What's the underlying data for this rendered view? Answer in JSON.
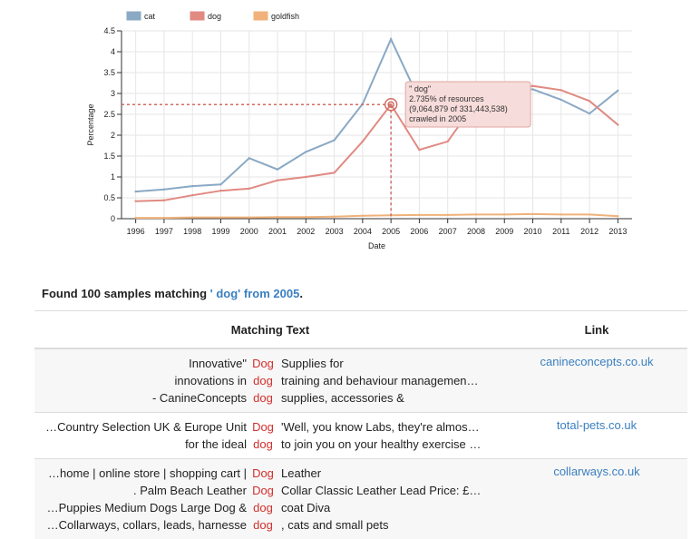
{
  "chart_data": {
    "type": "line",
    "xlabel": "Date",
    "ylabel": "Percentage",
    "x": [
      1996,
      1997,
      1998,
      1999,
      2000,
      2001,
      2002,
      2003,
      2004,
      2005,
      2006,
      2007,
      2008,
      2009,
      2010,
      2011,
      2012,
      2013
    ],
    "ylim": [
      0,
      4.5
    ],
    "yticks": [
      "0",
      "0.5",
      "1",
      "1.5",
      "2",
      "2.5",
      "3",
      "3.5",
      "4",
      "4.5"
    ],
    "legend_position": "top-left",
    "series": [
      {
        "name": "cat",
        "color": "#8aa9c4",
        "values": [
          0.65,
          0.7,
          0.78,
          0.82,
          1.45,
          1.18,
          1.6,
          1.88,
          2.75,
          4.3,
          2.85,
          2.9,
          2.95,
          3.05,
          3.1,
          2.85,
          2.52,
          3.07
        ]
      },
      {
        "name": "dog",
        "color": "#e08a82",
        "values": [
          0.42,
          0.44,
          0.56,
          0.67,
          0.72,
          0.92,
          1.0,
          1.1,
          1.85,
          2.735,
          1.65,
          1.85,
          2.8,
          3.0,
          3.18,
          3.08,
          2.82,
          2.25
        ]
      },
      {
        "name": "goldfish",
        "color": "#f0b27a",
        "values": [
          0.02,
          0.02,
          0.03,
          0.03,
          0.03,
          0.04,
          0.04,
          0.05,
          0.07,
          0.08,
          0.09,
          0.09,
          0.1,
          0.1,
          0.11,
          0.1,
          0.1,
          0.06
        ]
      }
    ],
    "highlight": {
      "series": "dog",
      "x": 2005,
      "y": 2.735
    },
    "tooltip": {
      "title": "\" dog\"",
      "line1": "2.735% of resources",
      "line2": "(9,064,879 of 331,443,538)",
      "line3": "crawled in 2005"
    }
  },
  "summary": {
    "prefix": "Found 100 samples matching ",
    "query": "' dog' from 2005",
    "suffix": "."
  },
  "table": {
    "headers": [
      "Matching Text",
      "Link"
    ],
    "rows": [
      {
        "lines": [
          {
            "pre": "Innovative\"",
            "kw": "Dog",
            "post": "Supplies for"
          },
          {
            "pre": "innovations in",
            "kw": "dog",
            "post": "training and behaviour managemen…"
          },
          {
            "pre": "- CanineConcepts",
            "kw": "dog",
            "post": "supplies, accessories &"
          }
        ],
        "link": "canineconcepts.co.uk"
      },
      {
        "lines": [
          {
            "pre": "…Country Selection UK & Europe Unit",
            "kw": "Dog",
            "post": "'Well, you know Labs, they're almos…"
          },
          {
            "pre": "for the ideal",
            "kw": "dog",
            "post": "to join you on your healthy exercise …"
          }
        ],
        "link": "total-pets.co.uk"
      },
      {
        "lines": [
          {
            "pre": "…home | online store | shopping cart |",
            "kw": "Dog",
            "post": "Leather"
          },
          {
            "pre": ". Palm Beach Leather",
            "kw": "Dog",
            "post": "Collar Classic Leather Lead Price: £…"
          },
          {
            "pre": "…Puppies Medium Dogs Large Dog &",
            "kw": "dog",
            "post": "coat Diva"
          },
          {
            "pre": "…Collarways, collars, leads, harnesse",
            "kw": "dog",
            "post": ", cats and small pets"
          }
        ],
        "link": "collarways.co.uk"
      }
    ]
  }
}
